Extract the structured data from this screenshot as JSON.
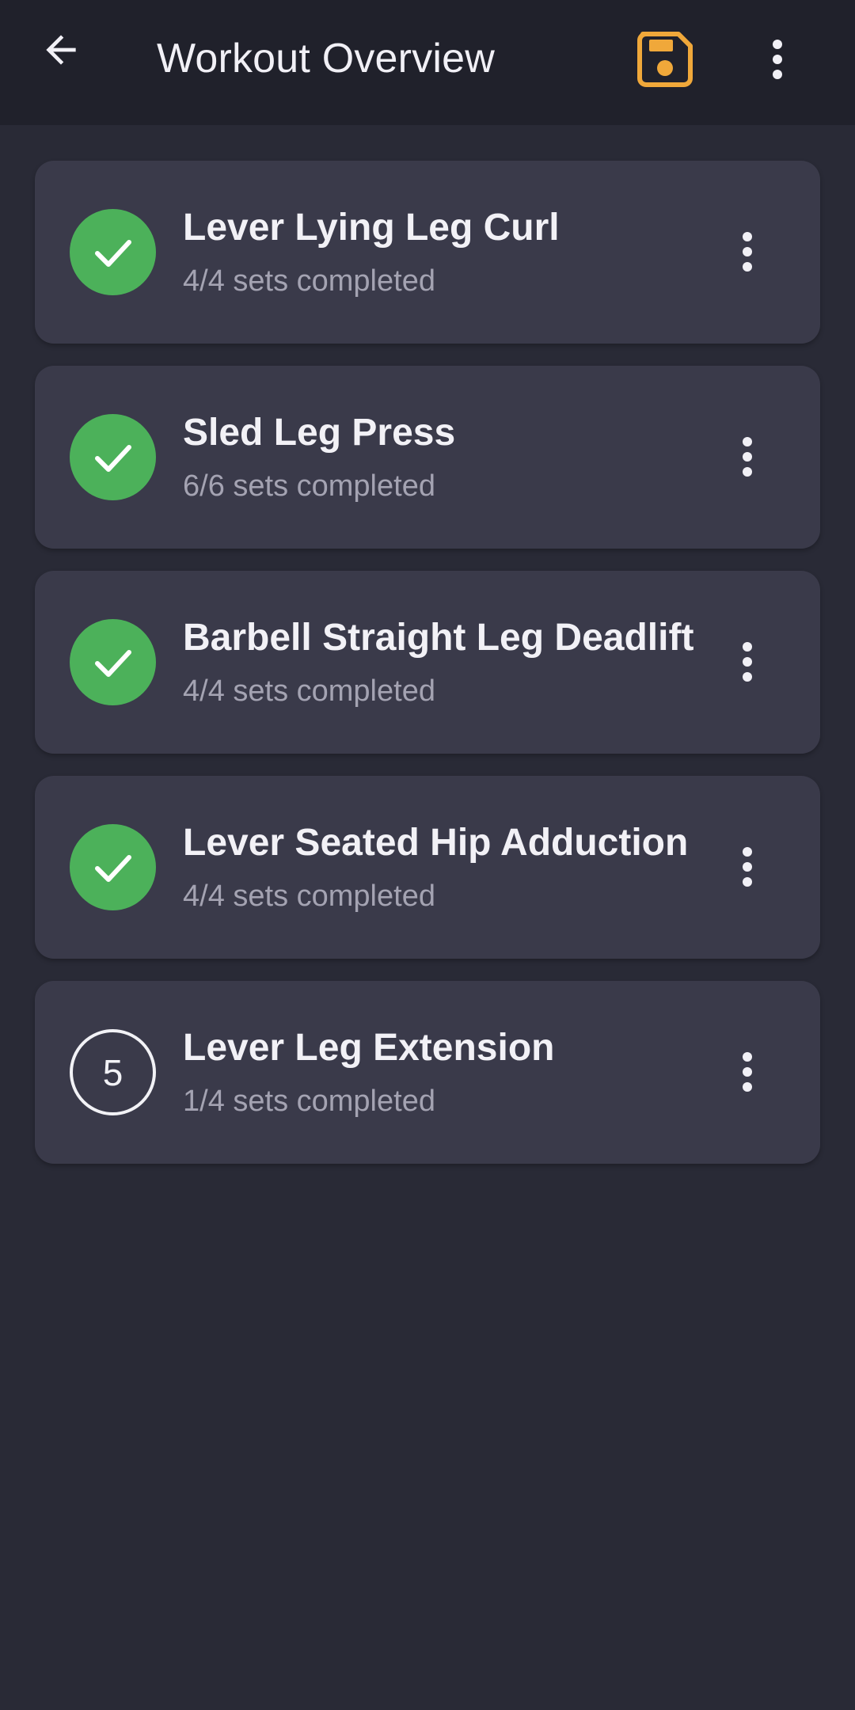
{
  "app_bar": {
    "title": "Workout Overview",
    "icons": {
      "back": "arrow-back-icon",
      "save": "save-icon",
      "overflow": "more-vert-icon"
    }
  },
  "colors": {
    "background": "#292a36",
    "app_bar": "#20212b",
    "card": "#3a3a4a",
    "completed": "#4cb15a",
    "save_accent": "#f0a83a",
    "secondary_text": "#a4a3b2"
  },
  "exercises": [
    {
      "name": "Lever Lying Leg Curl",
      "progress": "4/4 sets completed",
      "status": "completed",
      "status_icon": "check-icon"
    },
    {
      "name": "Sled Leg Press",
      "progress": "6/6 sets completed",
      "status": "completed",
      "status_icon": "check-icon"
    },
    {
      "name": "Barbell Straight Leg Deadlift",
      "progress": "4/4 sets completed",
      "status": "completed",
      "status_icon": "check-icon"
    },
    {
      "name": "Lever Seated Hip Adduction",
      "progress": "4/4 sets completed",
      "status": "completed",
      "status_icon": "check-icon"
    },
    {
      "name": "Lever Leg Extension",
      "progress": "1/4 sets completed",
      "status": "pending",
      "status_number": "5"
    }
  ]
}
